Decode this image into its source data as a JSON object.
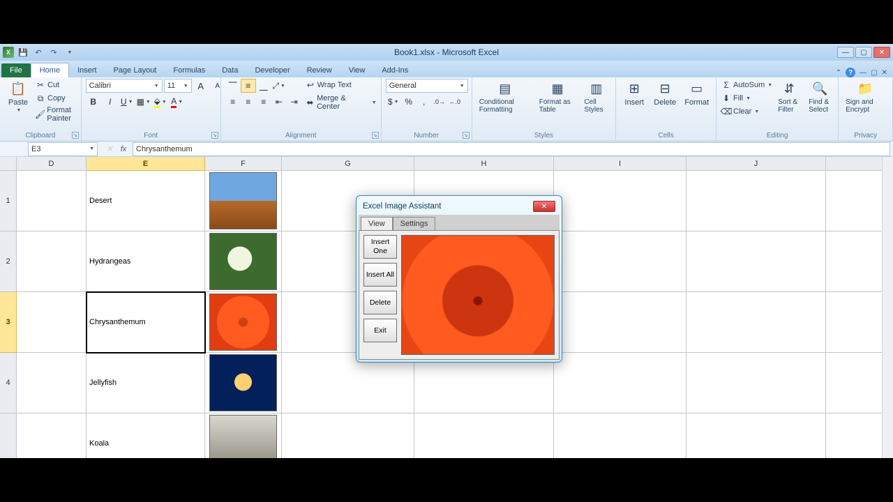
{
  "titlebar": {
    "title": "Book1.xlsx - Microsoft Excel"
  },
  "tabs": {
    "file": "File",
    "items": [
      "Home",
      "Insert",
      "Page Layout",
      "Formulas",
      "Data",
      "Developer",
      "Review",
      "View",
      "Add-Ins"
    ],
    "active": "Home"
  },
  "clipboard": {
    "paste": "Paste",
    "cut": "Cut",
    "copy": "Copy",
    "painter": "Format Painter",
    "label": "Clipboard"
  },
  "font": {
    "name": "Calibri",
    "size": "11",
    "bold": "B",
    "italic": "I",
    "underline": "U",
    "label": "Font"
  },
  "alignment": {
    "wrap": "Wrap Text",
    "merge": "Merge & Center",
    "label": "Alignment"
  },
  "number": {
    "format": "General",
    "label": "Number"
  },
  "styles": {
    "cond": "Conditional Formatting",
    "table": "Format as Table",
    "cell": "Cell Styles",
    "label": "Styles"
  },
  "cells": {
    "insert": "Insert",
    "delete": "Delete",
    "format": "Format",
    "label": "Cells"
  },
  "editing": {
    "sum": "AutoSum",
    "fill": "Fill",
    "clear": "Clear",
    "sort": "Sort & Filter",
    "find": "Find & Select",
    "label": "Editing"
  },
  "privacy": {
    "sign": "Sign and Encrypt",
    "label": "Privacy"
  },
  "namebox": {
    "value": "E3"
  },
  "formulabar": {
    "value": "Chrysanthemum"
  },
  "columns": [
    "D",
    "E",
    "F",
    "G",
    "H",
    "I",
    "J"
  ],
  "rows": [
    "1",
    "2",
    "3",
    "4",
    ""
  ],
  "activeCol": "E",
  "activeRow": "3",
  "data": {
    "E1": "Desert",
    "E2": "Hydrangeas",
    "E3": "Chrysanthemum",
    "E4": "Jellyfish",
    "E5": "Koala"
  },
  "dialog": {
    "title": "Excel  Image  Assistant",
    "tabs": {
      "view": "View",
      "settings": "Settings"
    },
    "buttons": {
      "insertOne": "Insert One",
      "insertAll": "Insert All",
      "delete": "Delete",
      "exit": "Exit"
    }
  }
}
